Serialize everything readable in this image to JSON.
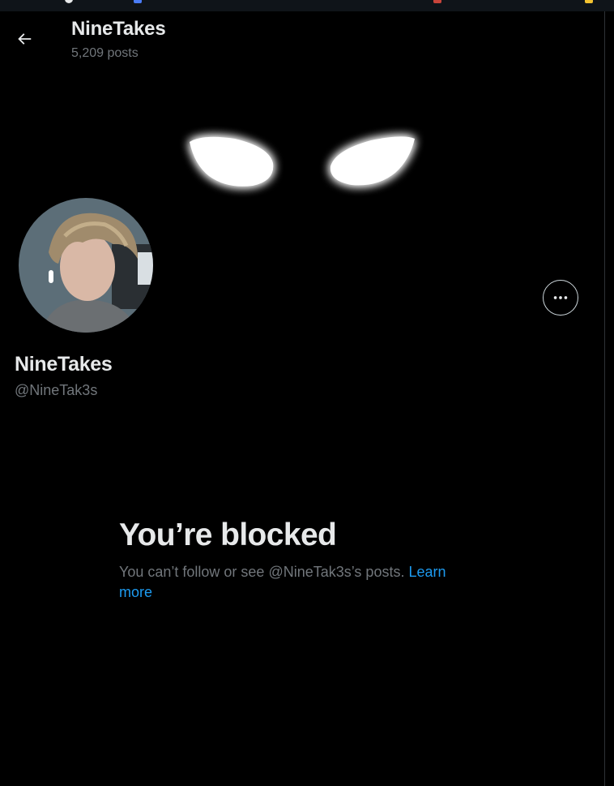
{
  "header": {
    "title": "NineTakes",
    "post_count": "5,209 posts"
  },
  "profile": {
    "display_name": "NineTakes",
    "handle": "@NineTak3s"
  },
  "blocked": {
    "title": "You’re blocked",
    "message": "You can’t follow or see @NineTak3s’s posts.",
    "link_label": "Learn more"
  },
  "icons": {
    "back": "arrow-left-icon",
    "more": "more-horizontal-icon"
  },
  "colors": {
    "background": "#000000",
    "primary_text": "#e7e9ea",
    "secondary_text": "#71767b",
    "link": "#1d9bf0"
  }
}
